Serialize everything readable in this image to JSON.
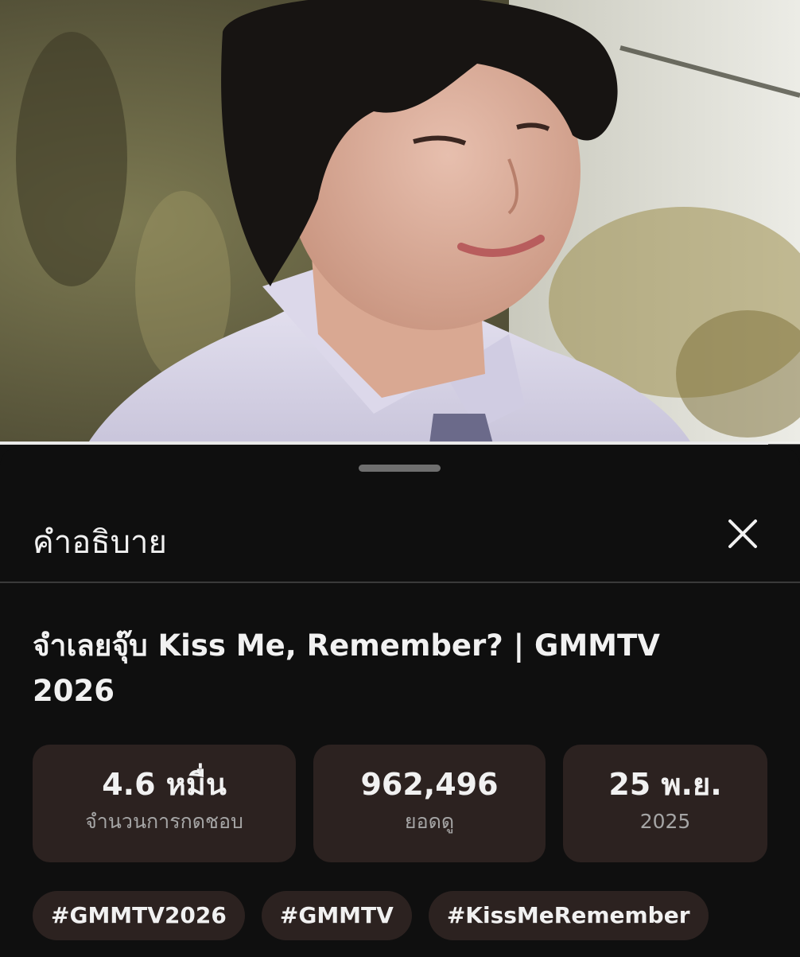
{
  "player": {
    "progress_fraction": 0.96
  },
  "sheet": {
    "title": "คำอธิบาย",
    "close_icon": "close-icon"
  },
  "video": {
    "title": "จำเลยจุ๊บ Kiss Me, Remember? | GMMTV 2026"
  },
  "stats": [
    {
      "value": "4.6 หมื่น",
      "label": "จำนวนการกดชอบ"
    },
    {
      "value": "962,496",
      "label": "ยอดดู"
    },
    {
      "value": "25 พ.ย.",
      "label": "2025"
    }
  ],
  "tags": [
    "#GMMTV2026",
    "#GMMTV",
    "#KissMeRemember"
  ],
  "colors": {
    "background": "#0f0f0f",
    "card": "#2c2220",
    "text_primary": "#f1f1f1",
    "text_secondary": "#a5a5a5"
  }
}
